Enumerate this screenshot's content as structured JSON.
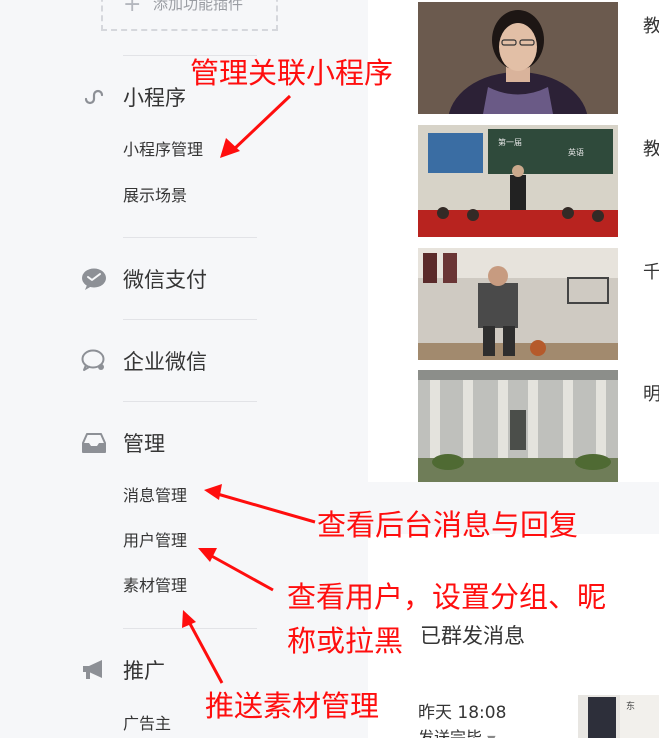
{
  "sidebar": {
    "add_plugin": {
      "label": "添加功能插件",
      "icon": "plus-icon"
    },
    "sections": {
      "miniprogram": {
        "title": "小程序",
        "icon": "miniprogram-icon",
        "items": [
          "小程序管理",
          "展示场景"
        ]
      },
      "wechat_pay": {
        "title": "微信支付",
        "icon": "wechat-pay-icon"
      },
      "work_wechat": {
        "title": "企业微信",
        "icon": "work-wechat-icon"
      },
      "manage": {
        "title": "管理",
        "icon": "inbox-icon",
        "items": [
          "消息管理",
          "用户管理",
          "素材管理"
        ]
      },
      "promotion": {
        "title": "推广",
        "icon": "megaphone-icon",
        "items": [
          "广告主"
        ]
      }
    }
  },
  "main": {
    "articles": [
      {
        "title": "教"
      },
      {
        "title": "教"
      },
      {
        "title": "千"
      },
      {
        "title": "明"
      }
    ],
    "mass_messages": {
      "section_title": "已群发消息",
      "time": "昨天 18:08",
      "status": "发送完毕"
    }
  },
  "annotations": {
    "miniprogram_note": "管理关联小程序",
    "message_note": "查看后台消息与回复",
    "user_note_line1": "查看用户，设置分组、昵",
    "user_note_line2": "称或拉黑",
    "material_note": "推送素材管理"
  },
  "colors": {
    "annotation": "#ff0e0e",
    "sidebar_bg": "#f6f7f9",
    "text": "#353535"
  }
}
